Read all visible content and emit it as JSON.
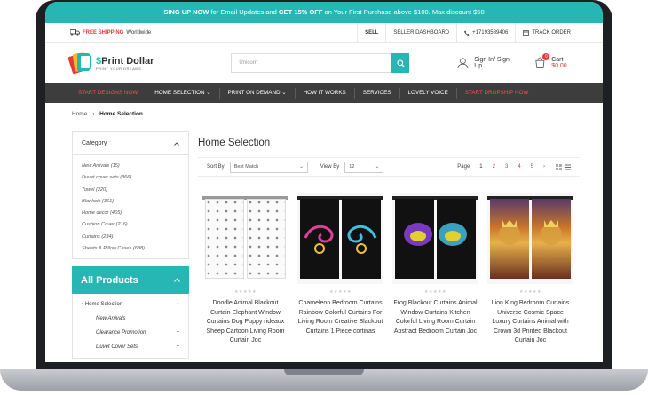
{
  "promo": {
    "p1": "SING UP NOW",
    "p2": " for Email Updates and ",
    "p3": "GET 15% OFF",
    "p4": " on Your First Purchase above $100. Max discount $50"
  },
  "topbar": {
    "shipping_bold": "FREE SHIPPING",
    "shipping_rest": "Worldwide",
    "sell": "SELL",
    "dashboard": "SELLER DASHBOARD",
    "phone": "+17193589406",
    "track": "TRACK ORDER"
  },
  "logo": {
    "name_s": "$",
    "name": "Print Dollar",
    "tagline": "PRINT YOUR DREAMS"
  },
  "search": {
    "placeholder": "Unicorn"
  },
  "account": {
    "label": "Sign In/ Sign Up"
  },
  "cart": {
    "label": "Cart",
    "price": "$0.00",
    "count": "0"
  },
  "nav": [
    {
      "label": "START DESIGNS NOW",
      "red": true
    },
    {
      "label": "HOME SELECTION ⌄",
      "red": false
    },
    {
      "label": "PRINT ON DEMAND ⌄",
      "red": false
    },
    {
      "label": "HOW IT WORKS",
      "red": false
    },
    {
      "label": "SERVICES",
      "red": false
    },
    {
      "label": "LOVELY VOICE",
      "red": false
    },
    {
      "label": "START DROPSHIP NOW",
      "red": true
    }
  ],
  "breadcrumb": {
    "home": "Home",
    "sep": "›",
    "current": "Home Selection"
  },
  "category": {
    "title": "Category",
    "items": [
      "New Arrivals (15)",
      "Duvet cover sets (366)",
      "Towel (220)",
      "Blankets (361)",
      "Home decor (465)",
      "Cushion Cover (216)",
      "Curtains (234)",
      "Sheets & Pillow Cases (688)"
    ]
  },
  "all_products": {
    "title": "All Products",
    "main": "Home Selection",
    "subs": [
      "New Arrivals",
      "Clearance Promotion",
      "Duvet Cover Sets"
    ]
  },
  "main": {
    "title": "Home Selection"
  },
  "toolbar": {
    "sort_label": "Sort By",
    "sort_value": "Best Match",
    "view_label": "View By",
    "view_value": "12",
    "page_label": "Page",
    "pages": [
      "1",
      "2",
      "3",
      "4",
      "5"
    ],
    "next": "›"
  },
  "products": [
    {
      "title": "Doodle Animal Blackout Curtain Elephant Window Curtains Dog Puppy rideaux Sheep Cartoon Living Room Curtain Joc",
      "rating": "★★★★★"
    },
    {
      "title": "Chameleon Bedroom Curtains Rainbow Colorful Curtains For Living Room Creative Blackout Curtains 1 Piece cortinas",
      "rating": "★★★★★"
    },
    {
      "title": "Frog Blackout Curtains Animal Window Curtains Kitchen Colorful Living Room Curtain Abstract Bedroom Curtain Joc",
      "rating": "★★★★★"
    },
    {
      "title": "Lion King Bedroom Curtains Universe Cosmic Space Luxury Curtains Animal with Crown 3d Printed Blackout Curtain Joc",
      "rating": "★★★★★"
    }
  ],
  "colors": {
    "accent": "#26b7b4",
    "red": "#e03a3a",
    "nav": "#3d3d3d"
  }
}
